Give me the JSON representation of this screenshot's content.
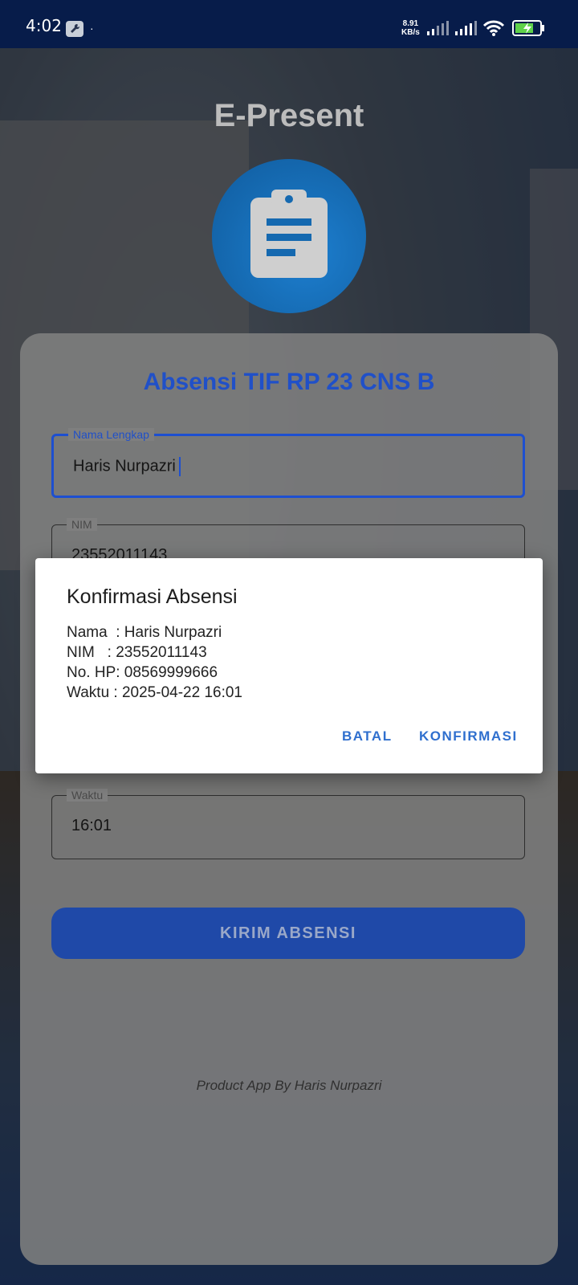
{
  "status_bar": {
    "time": "4:02",
    "notification_dot": "·",
    "net_speed_value": "8.91",
    "net_speed_unit": "KB/s"
  },
  "app": {
    "title": "E-Present",
    "logo_icon": "clipboard-icon"
  },
  "form": {
    "title": "Absensi TIF RP 23 CNS B",
    "fields": [
      {
        "label": "Nama Lengkap",
        "value": "Haris Nurpazri"
      },
      {
        "label": "NIM",
        "value": "23552011143"
      },
      {
        "label": "Waktu",
        "value": "16:01"
      }
    ],
    "submit_label": "KIRIM ABSENSI",
    "footer": "Product App By Haris Nurpazri"
  },
  "dialog": {
    "title": "Konfirmasi Absensi",
    "lines": [
      "Nama  : Haris Nurpazri",
      "NIM   : 23552011143",
      "No. HP: 08569999666",
      "Waktu : 2025-04-22 16:01"
    ],
    "cancel_label": "BATAL",
    "confirm_label": "KONFIRMASI"
  },
  "colors": {
    "accent": "#2050c8",
    "dialog_button": "#2f6fce",
    "status_bar": "#071c4a"
  }
}
